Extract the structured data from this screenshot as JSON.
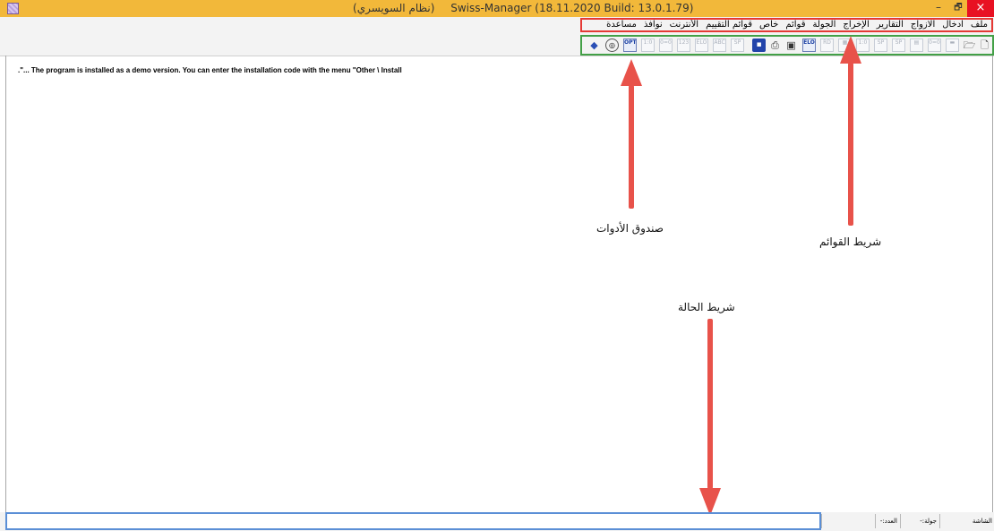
{
  "window": {
    "title_arabic": "(نظام السويسري)",
    "title_main": "Swiss-Manager (18.11.2020 Build: 13.0.1.79)",
    "minimize_glyph": "–",
    "maximize_glyph": "🗗",
    "close_glyph": "×"
  },
  "menubar": {
    "items": [
      "ملف",
      "ادخال",
      "الازواج",
      "التقارير",
      "الإخراج",
      "الجولة",
      "قوائم",
      "خاص",
      "قوائم التقييم",
      "الأنترنت",
      "نوافذ",
      "مساعدة"
    ]
  },
  "toolbar": {
    "icon_names": [
      "new-file-icon",
      "open-folder-icon",
      "save-icon",
      "pairing-icon",
      "rank-icon",
      "sp-icon",
      "sp2-icon",
      "one-zero-icon",
      "table-icon",
      "rd-icon",
      "elo-icon",
      "screen-icon",
      "print-icon",
      "disk-icon",
      "sp3-icon",
      "abc-icon",
      "elo2-icon",
      "one-two-three-icon",
      "zero-zero-icon",
      "one-zero2-icon",
      "opt-icon",
      "globe-icon",
      "book-icon"
    ],
    "button_labels": {
      "one_zero": "1:0",
      "zero_zero": "0=0",
      "sp": "SP",
      "rd": "RD",
      "elo": "ELO",
      "abc": "ABC",
      "one_two_three": "123",
      "opt": "OPT",
      "zero_equals": "0=0"
    }
  },
  "content": {
    "message": ".\"... The program is installed as a demo version. You can enter the installation code with the menu \"Other \\ Install"
  },
  "annotations": {
    "toolbox_label": "صندوق الأدوات",
    "menubar_label": "شريط القوائم",
    "statusbar_label": "شريط الحالة"
  },
  "statusbar": {
    "round_label": "جولة:-",
    "count_label": "العدد:-",
    "screen_label": "الشاشة"
  },
  "colors": {
    "titlebar": "#f2b83a",
    "menu_frame": "#e53935",
    "toolbar_frame": "#43a047",
    "status_frame": "#5b8fd6",
    "arrow": "#e8524a",
    "close_button": "#e81123"
  }
}
